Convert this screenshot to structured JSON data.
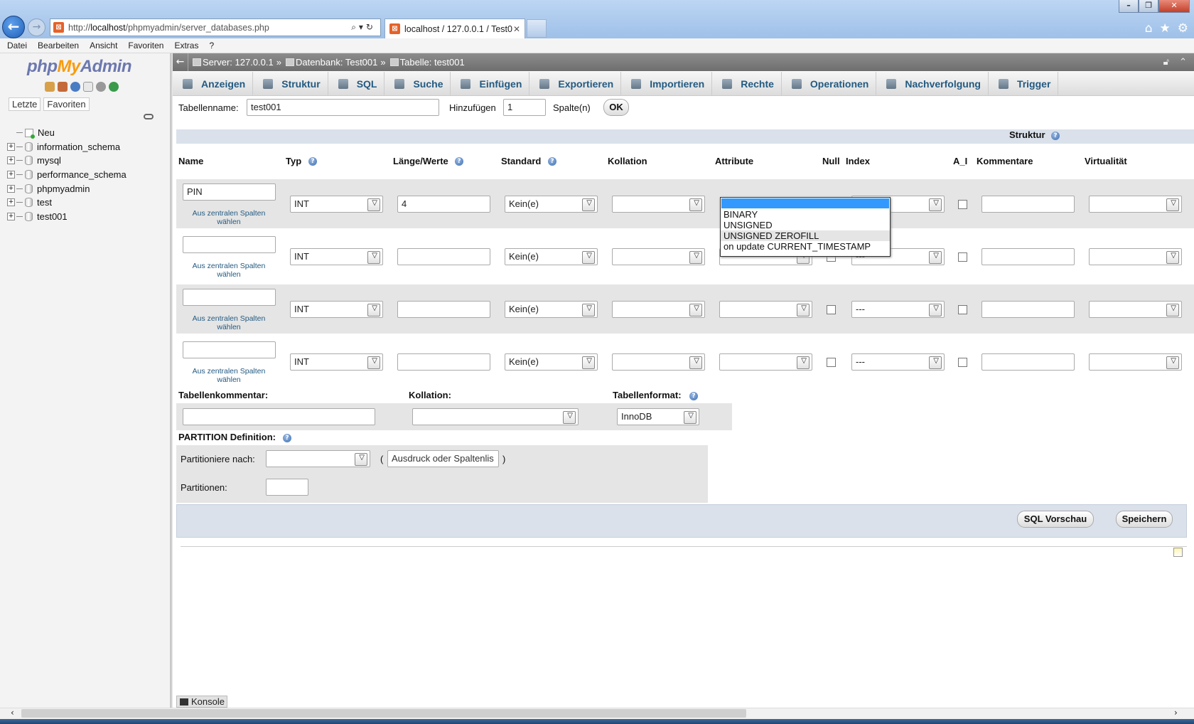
{
  "browser": {
    "url_prefix": "http://",
    "url_host": "localhost",
    "url_path": "/phpmyadmin/server_databases.php",
    "tab_title": "localhost / 127.0.0.1 / Test0...",
    "menu": [
      "Datei",
      "Bearbeiten",
      "Ansicht",
      "Favoriten",
      "Extras",
      "?"
    ]
  },
  "nav": {
    "logo_php": "php",
    "logo_my": "My",
    "logo_admin": "Admin",
    "tabs": [
      "Letzte",
      "Favoriten"
    ],
    "tree": [
      {
        "label": "Neu",
        "type": "new"
      },
      {
        "label": "information_schema",
        "type": "db"
      },
      {
        "label": "mysql",
        "type": "db"
      },
      {
        "label": "performance_schema",
        "type": "db"
      },
      {
        "label": "phpmyadmin",
        "type": "db"
      },
      {
        "label": "test",
        "type": "db"
      },
      {
        "label": "test001",
        "type": "db"
      }
    ]
  },
  "breadcrumb": {
    "server": "Server: 127.0.0.1",
    "database": "Datenbank: Test001",
    "table": "Tabelle: test001",
    "sep": "»"
  },
  "topmenu": [
    "Anzeigen",
    "Struktur",
    "SQL",
    "Suche",
    "Einfügen",
    "Exportieren",
    "Importieren",
    "Rechte",
    "Operationen",
    "Nachverfolgung",
    "Trigger"
  ],
  "form": {
    "table_name_label": "Tabellenname:",
    "table_name_value": "test001",
    "add_label": "Hinzufügen",
    "add_value": "1",
    "columns_label": "Spalte(n)",
    "ok_label": "OK",
    "structure_label": "Struktur",
    "headers": {
      "name": "Name",
      "type": "Typ",
      "length": "Länge/Werte",
      "default": "Standard",
      "collation": "Kollation",
      "attributes": "Attribute",
      "null": "Null",
      "index": "Index",
      "ai": "A_I",
      "comments": "Kommentare",
      "virtuality": "Virtualität"
    },
    "central_link": "Aus zentralen Spalten wählen",
    "rows": [
      {
        "name": "PIN",
        "type": "INT",
        "length": "4",
        "default": "Kein(e)",
        "index": "---"
      },
      {
        "name": "",
        "type": "INT",
        "length": "",
        "default": "Kein(e)",
        "index": "---"
      },
      {
        "name": "",
        "type": "INT",
        "length": "",
        "default": "Kein(e)",
        "index": "---"
      },
      {
        "name": "",
        "type": "INT",
        "length": "",
        "default": "Kein(e)",
        "index": "---"
      }
    ],
    "attribute_options": [
      "",
      "BINARY",
      "UNSIGNED",
      "UNSIGNED ZEROFILL",
      "on update CURRENT_TIMESTAMP"
    ],
    "table_comment_label": "Tabellenkommentar:",
    "collation_label": "Kollation:",
    "table_format_label": "Tabellenformat:",
    "table_format_value": "InnoDB",
    "partition_label": "PARTITION Definition:",
    "partition_by_label": "Partitioniere nach:",
    "partition_expr_placeholder": "Ausdruck oder Spaltenlis",
    "paren_open": "(",
    "paren_close": ")",
    "partitions_label": "Partitionen:",
    "sql_preview_label": "SQL Vorschau",
    "save_label": "Speichern"
  },
  "console_label": "Konsole"
}
